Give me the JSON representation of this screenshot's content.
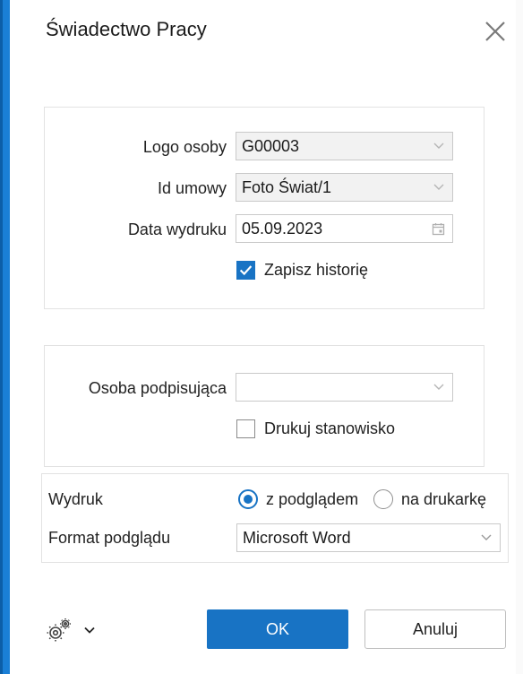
{
  "dialog": {
    "title": "Świadectwo Pracy"
  },
  "main_panel": {
    "logo_osoby": {
      "label": "Logo osoby",
      "value": "G00003"
    },
    "id_umowy": {
      "label": "Id umowy",
      "value": "Foto Świat/1"
    },
    "data_wydruku": {
      "label": "Data wydruku",
      "value": "05.09.2023"
    },
    "zapisz_historie": {
      "label": "Zapisz historię",
      "checked": true
    }
  },
  "signer_panel": {
    "osoba_podpisujaca": {
      "label": "Osoba podpisująca",
      "value": ""
    },
    "drukuj_stanowisko": {
      "label": "Drukuj stanowisko",
      "checked": false
    }
  },
  "print_panel": {
    "wydruk_label": "Wydruk",
    "option_preview": "z podglądem",
    "option_printer": "na drukarkę",
    "selected": "z podglądem",
    "format_label": "Format podglądu",
    "format_value": "Microsoft Word"
  },
  "footer": {
    "ok_label": "OK",
    "cancel_label": "Anuluj"
  },
  "colors": {
    "accent": "#1873c4",
    "window_edge": "#1a7fd6"
  },
  "icons": [
    "close-icon",
    "chevron-down-icon",
    "calendar-icon",
    "checkmark-icon",
    "gear-icon"
  ]
}
